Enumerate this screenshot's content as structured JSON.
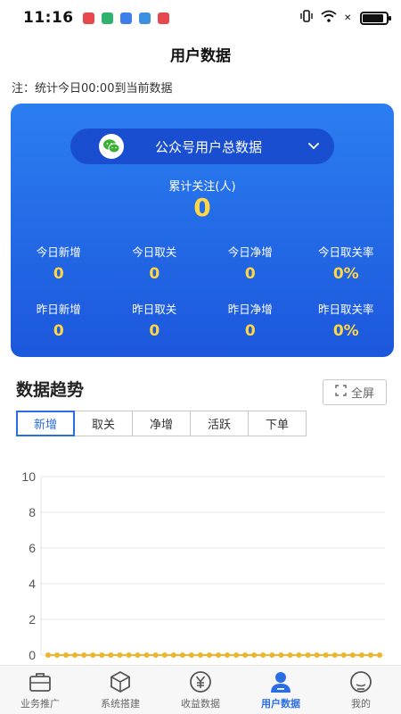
{
  "status": {
    "time": "11:16",
    "apps": [
      "#e5484d",
      "#2fb26b",
      "#3d7ee9",
      "#3d8fe0",
      "#e5484d"
    ],
    "battery_level": 0.9
  },
  "header": {
    "title": "用户数据",
    "note": "注：统计今日00:00到当前数据"
  },
  "card": {
    "selector_label": "公众号用户总数据",
    "total_label": "累计关注(人)",
    "total_value": "0",
    "today": [
      {
        "label": "今日新增",
        "value": "0"
      },
      {
        "label": "今日取关",
        "value": "0"
      },
      {
        "label": "今日净增",
        "value": "0"
      },
      {
        "label": "今日取关率",
        "value": "0%"
      }
    ],
    "yesterday": [
      {
        "label": "昨日新增",
        "value": "0"
      },
      {
        "label": "昨日取关",
        "value": "0"
      },
      {
        "label": "昨日净增",
        "value": "0"
      },
      {
        "label": "昨日取关率",
        "value": "0%"
      }
    ]
  },
  "trend": {
    "title": "数据趋势",
    "fullscreen_label": "全屏",
    "tabs": [
      "新增",
      "取关",
      "净增",
      "活跃",
      "下单"
    ],
    "active_tab": 0
  },
  "chart_data": {
    "type": "line",
    "y_ticks": [
      "0",
      "2",
      "4",
      "6",
      "8",
      "10"
    ],
    "ylim": [
      0,
      10
    ],
    "values": [
      0,
      0,
      0,
      0,
      0,
      0,
      0,
      0,
      0,
      0,
      0,
      0,
      0,
      0,
      0,
      0,
      0,
      0,
      0,
      0,
      0,
      0,
      0,
      0,
      0,
      0,
      0,
      0,
      0,
      0,
      0,
      0,
      0,
      0,
      0,
      0,
      0,
      0
    ],
    "line_color": "#f0b429",
    "grid": true
  },
  "nav": {
    "items": [
      "业务推广",
      "系统搭建",
      "收益数据",
      "用户数据",
      "我的"
    ],
    "active": 3
  },
  "colors": {
    "accent": "#2a6ee6",
    "highlight": "#ffd745"
  }
}
